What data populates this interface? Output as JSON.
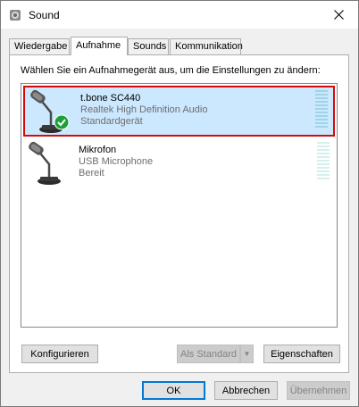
{
  "window": {
    "title": "Sound",
    "icon": "speaker-icon"
  },
  "tabs": [
    {
      "label": "Wiedergabe",
      "active": false
    },
    {
      "label": "Aufnahme",
      "active": true
    },
    {
      "label": "Sounds",
      "active": false
    },
    {
      "label": "Kommunikation",
      "active": false
    }
  ],
  "panel": {
    "instruction": "Wählen Sie ein Aufnahmegerät aus, um die Einstellungen zu ändern:"
  },
  "devices": [
    {
      "name": "t.bone SC440",
      "description": "Realtek High Definition Audio",
      "status": "Standardgerät",
      "icon": "microphone-icon",
      "default_badge": "green-check-icon",
      "selected": true
    },
    {
      "name": "Mikrofon",
      "description": "USB Microphone",
      "status": "Bereit",
      "icon": "microphone-icon",
      "selected": false
    }
  ],
  "panel_buttons": {
    "configure": "Konfigurieren",
    "set_default": "Als Standard",
    "properties": "Eigenschaften"
  },
  "dialog_buttons": {
    "ok": "OK",
    "cancel": "Abbrechen",
    "apply": "Übernehmen"
  },
  "colors": {
    "selection_bg": "#cce8ff",
    "highlight_border": "#d40b0b",
    "default_button_border": "#0078d7"
  }
}
